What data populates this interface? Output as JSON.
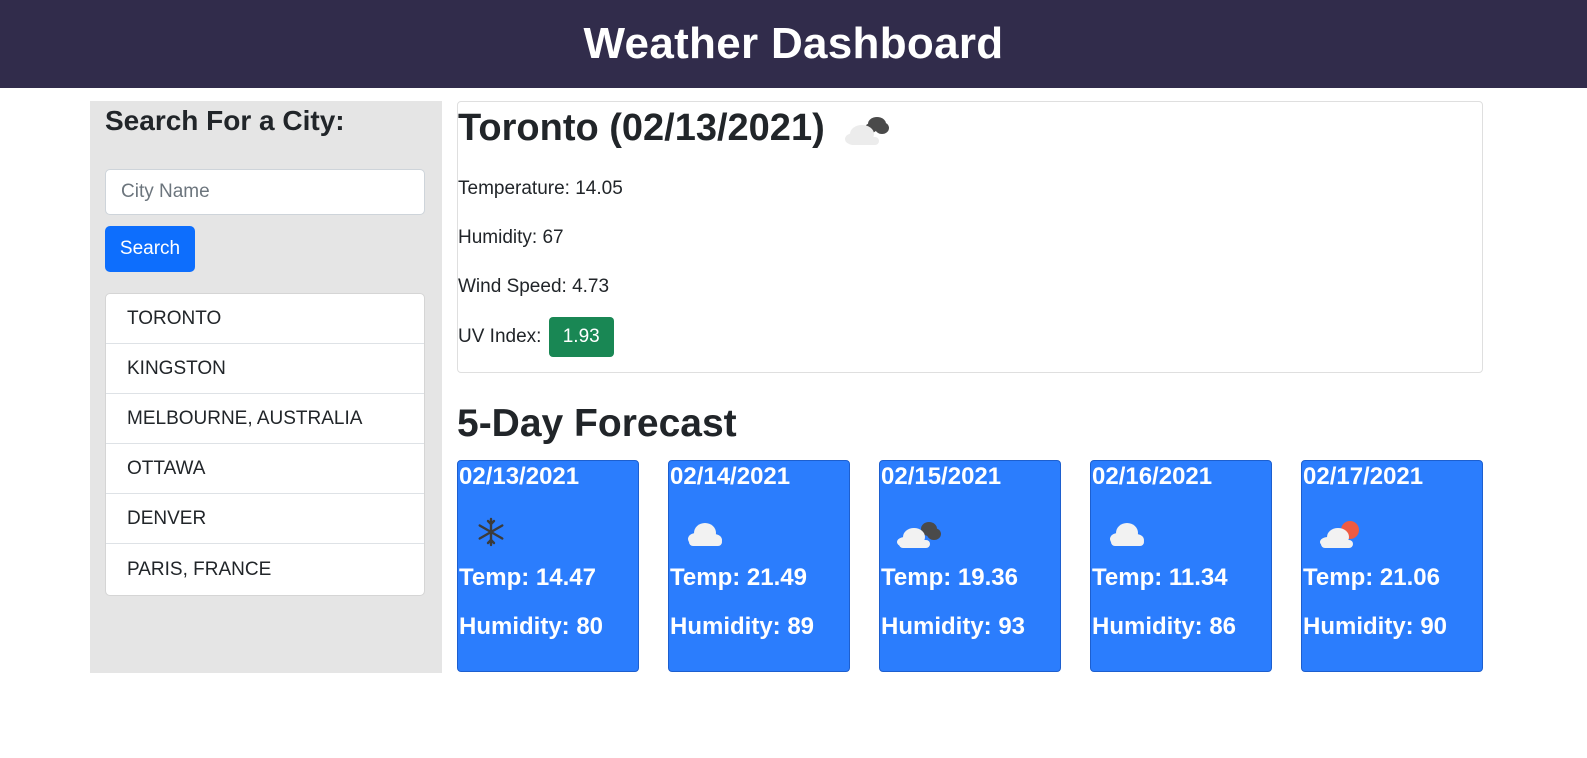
{
  "header": {
    "title": "Weather Dashboard"
  },
  "sidebar": {
    "title": "Search For a City:",
    "search_placeholder": "City Name",
    "search_value": "",
    "search_button": "Search",
    "history": [
      "TORONTO",
      "KINGSTON",
      "MELBOURNE, AUSTRALIA",
      "OTTAWA",
      "DENVER",
      "PARIS, FRANCE"
    ]
  },
  "current": {
    "title": "Toronto (02/13/2021)",
    "icon": "broken-clouds",
    "temperature": "Temperature: 14.05",
    "humidity": "Humidity: 67",
    "wind_speed": "Wind Speed: 4.73",
    "uv_label": "UV Index:",
    "uv_value": "1.93",
    "uv_color": "#198754"
  },
  "forecast": {
    "title": "5-Day Forecast",
    "card_color": "#2b7dfd",
    "days": [
      {
        "date": "02/13/2021",
        "icon": "snow",
        "temp": "Temp: 14.47",
        "humidity": "Humidity: 80"
      },
      {
        "date": "02/14/2021",
        "icon": "cloud",
        "temp": "Temp: 21.49",
        "humidity": "Humidity: 89"
      },
      {
        "date": "02/15/2021",
        "icon": "broken-clouds",
        "temp": "Temp: 19.36",
        "humidity": "Humidity: 93"
      },
      {
        "date": "02/16/2021",
        "icon": "cloud",
        "temp": "Temp: 11.34",
        "humidity": "Humidity: 86"
      },
      {
        "date": "02/17/2021",
        "icon": "partly-cloudy",
        "temp": "Temp: 21.06",
        "humidity": "Humidity: 90"
      }
    ]
  }
}
